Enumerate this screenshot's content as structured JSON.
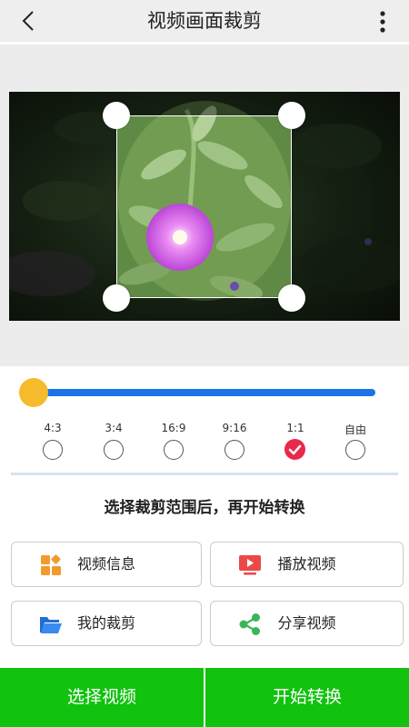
{
  "header": {
    "title": "视频画面裁剪",
    "back_icon": "back-chevron-icon",
    "more_icon": "more-vertical-icon"
  },
  "preview": {
    "image": "flower-photo",
    "crop_ratio_selected": "1:1"
  },
  "slider": {
    "position": 0.04,
    "accent_color": "#1a73e8",
    "thumb_color": "#f5bb2c"
  },
  "ratios": [
    {
      "label": "4:3",
      "checked": false
    },
    {
      "label": "3:4",
      "checked": false
    },
    {
      "label": "16:9",
      "checked": false
    },
    {
      "label": "9:16",
      "checked": false
    },
    {
      "label": "1:1",
      "checked": true
    },
    {
      "label": "自由",
      "checked": false
    }
  ],
  "hint": "选择裁剪范围后，再开始转换",
  "actions": {
    "video_info": {
      "label": "视频信息",
      "icon": "grid-apps-icon"
    },
    "play_video": {
      "label": "播放视频",
      "icon": "video-play-icon"
    },
    "my_crops": {
      "label": "我的裁剪",
      "icon": "folder-open-icon"
    },
    "share_video": {
      "label": "分享视频",
      "icon": "share-icon"
    }
  },
  "bottom": {
    "select_video": "选择视频",
    "start_convert": "开始转换",
    "color": "#11c20e"
  }
}
